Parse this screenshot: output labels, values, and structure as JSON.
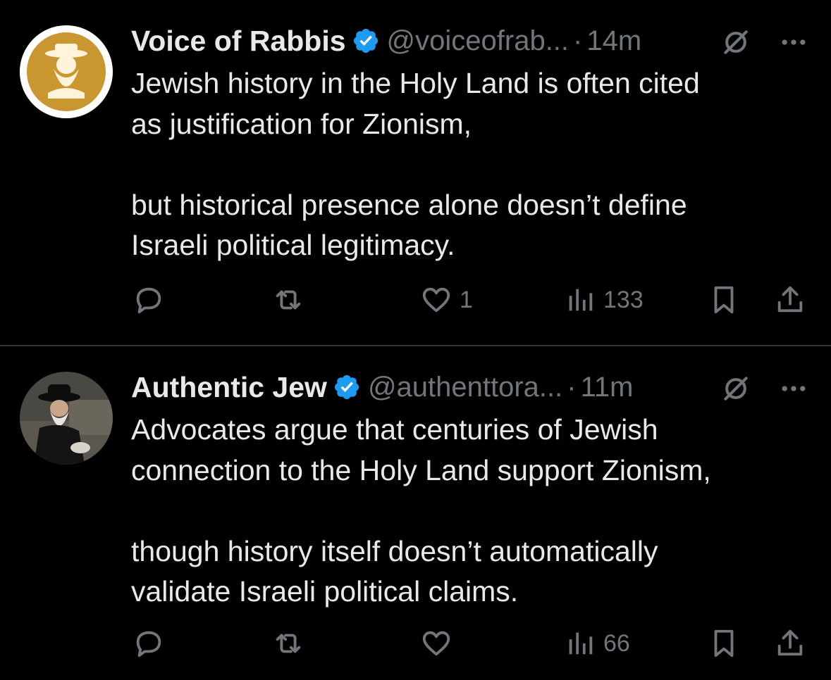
{
  "posts": [
    {
      "name": "Voice of Rabbis",
      "handle": "@voiceofrab...",
      "separator": "·",
      "time": "14m",
      "paragraphs": [
        "Jewish history in the Holy Land is often cited\nas justification for Zionism,",
        "but historical presence alone doesn’t define\nIsraeli political legitimacy."
      ],
      "like_count": "1",
      "view_count": "133",
      "avatar_bg": "#c9962f"
    },
    {
      "name": "Authentic Jew",
      "handle": "@authenttora...",
      "separator": "·",
      "time": "11m",
      "paragraphs": [
        "Advocates argue that centuries of Jewish\nconnection to the Holy Land support Zionism,",
        "though history itself doesn’t automatically\nvalidate Israeli political claims."
      ],
      "like_count": "",
      "view_count": "66",
      "avatar_bg": "#3a3a3a"
    }
  ],
  "icons": {
    "verified": "verified-badge-icon",
    "grok": "grok-icon",
    "more": "more-icon",
    "reply": "reply-icon",
    "repost": "repost-icon",
    "like": "heart-icon",
    "views": "views-icon",
    "bookmark": "bookmark-icon",
    "share": "share-icon"
  },
  "colors": {
    "verified": "#1d9bf0",
    "muted": "#71767b",
    "text": "#e7e9ea",
    "divider": "#2f3336"
  }
}
